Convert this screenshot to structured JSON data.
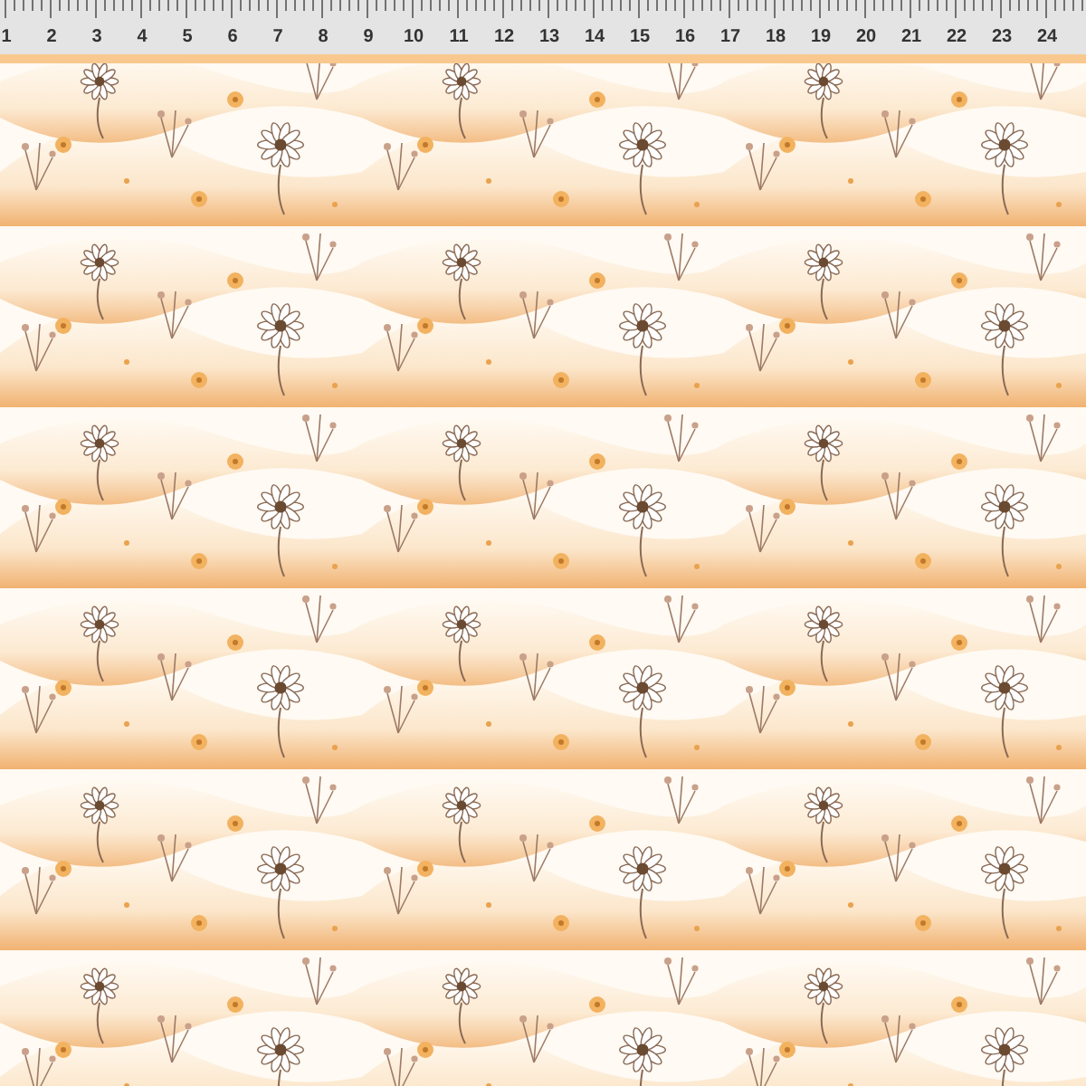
{
  "ruler": {
    "labels": [
      "1",
      "2",
      "3",
      "4",
      "5",
      "6",
      "7",
      "8",
      "9",
      "10",
      "11",
      "12",
      "13",
      "14",
      "15",
      "16",
      "17",
      "18",
      "19",
      "20",
      "21",
      "22",
      "23",
      "24"
    ]
  }
}
